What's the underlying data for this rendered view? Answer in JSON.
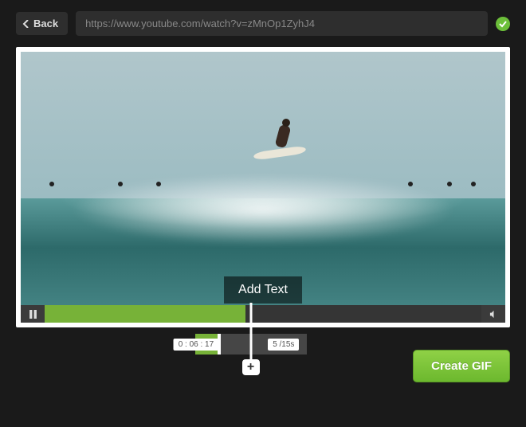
{
  "header": {
    "back_label": "Back",
    "url_value": "https://www.youtube.com/watch?v=zMnOp1ZyhJ4",
    "status": "valid"
  },
  "video": {
    "add_text_label": "Add Text",
    "progress_percent": 46
  },
  "timeline": {
    "start_time": "0 : 06 : 17",
    "duration_label": "5 /15s",
    "expand_label": "+"
  },
  "actions": {
    "create_label": "Create GIF"
  },
  "colors": {
    "accent": "#77b238",
    "create_green": "#6cb82e"
  }
}
